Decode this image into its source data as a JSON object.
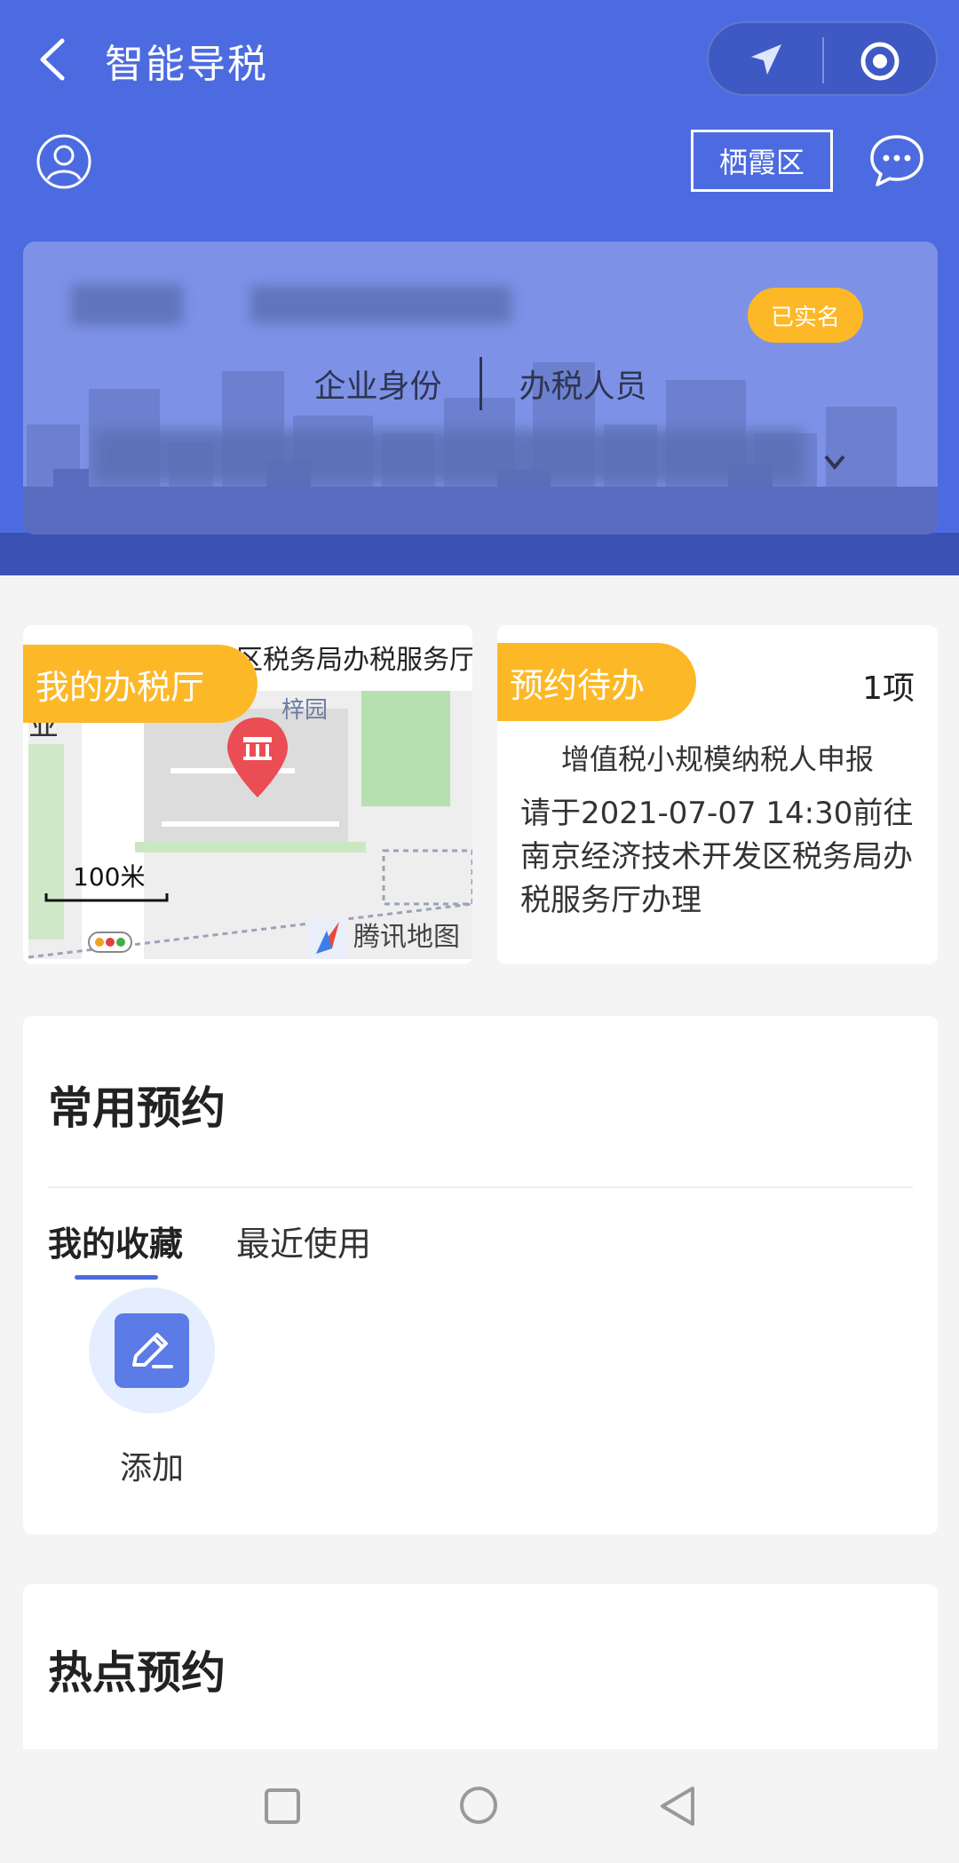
{
  "header": {
    "title": "智能导税",
    "district": "栖霞区"
  },
  "identity": {
    "badge": "已实名",
    "role_left": "企业身份",
    "role_right": "办税人员"
  },
  "hall": {
    "tag": "我的办税厅",
    "name": "区税务局办税服务厅",
    "map_scale": "100米",
    "map_brand": "腾讯地图"
  },
  "todo": {
    "tag": "预约待办",
    "count": "1项",
    "title": "增值税小规模纳税人申报",
    "desc": "请于2021-07-07 14:30前往南京经济技术开发区税务局办税服务厅办理"
  },
  "common": {
    "title": "常用预约",
    "tabs": [
      "我的收藏",
      "最近使用"
    ],
    "add_label": "添加"
  },
  "hot": {
    "title": "热点预约"
  },
  "colors": {
    "brand_blue": "#4d6be0",
    "accent_orange": "#fdb827"
  }
}
